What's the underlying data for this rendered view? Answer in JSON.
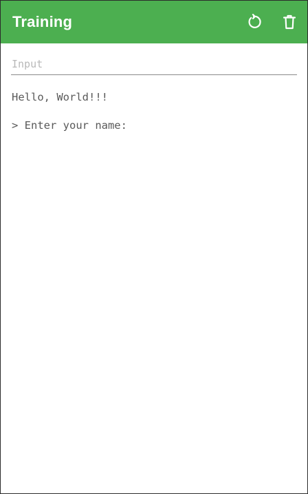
{
  "app_bar": {
    "title": "Training",
    "background_color": "#4caf50",
    "actions": [
      {
        "icon": "reset-icon"
      },
      {
        "icon": "delete-icon"
      }
    ]
  },
  "input": {
    "placeholder": "Input",
    "value": ""
  },
  "console": {
    "lines": [
      "Hello, World!!!",
      "> Enter your name:"
    ]
  }
}
